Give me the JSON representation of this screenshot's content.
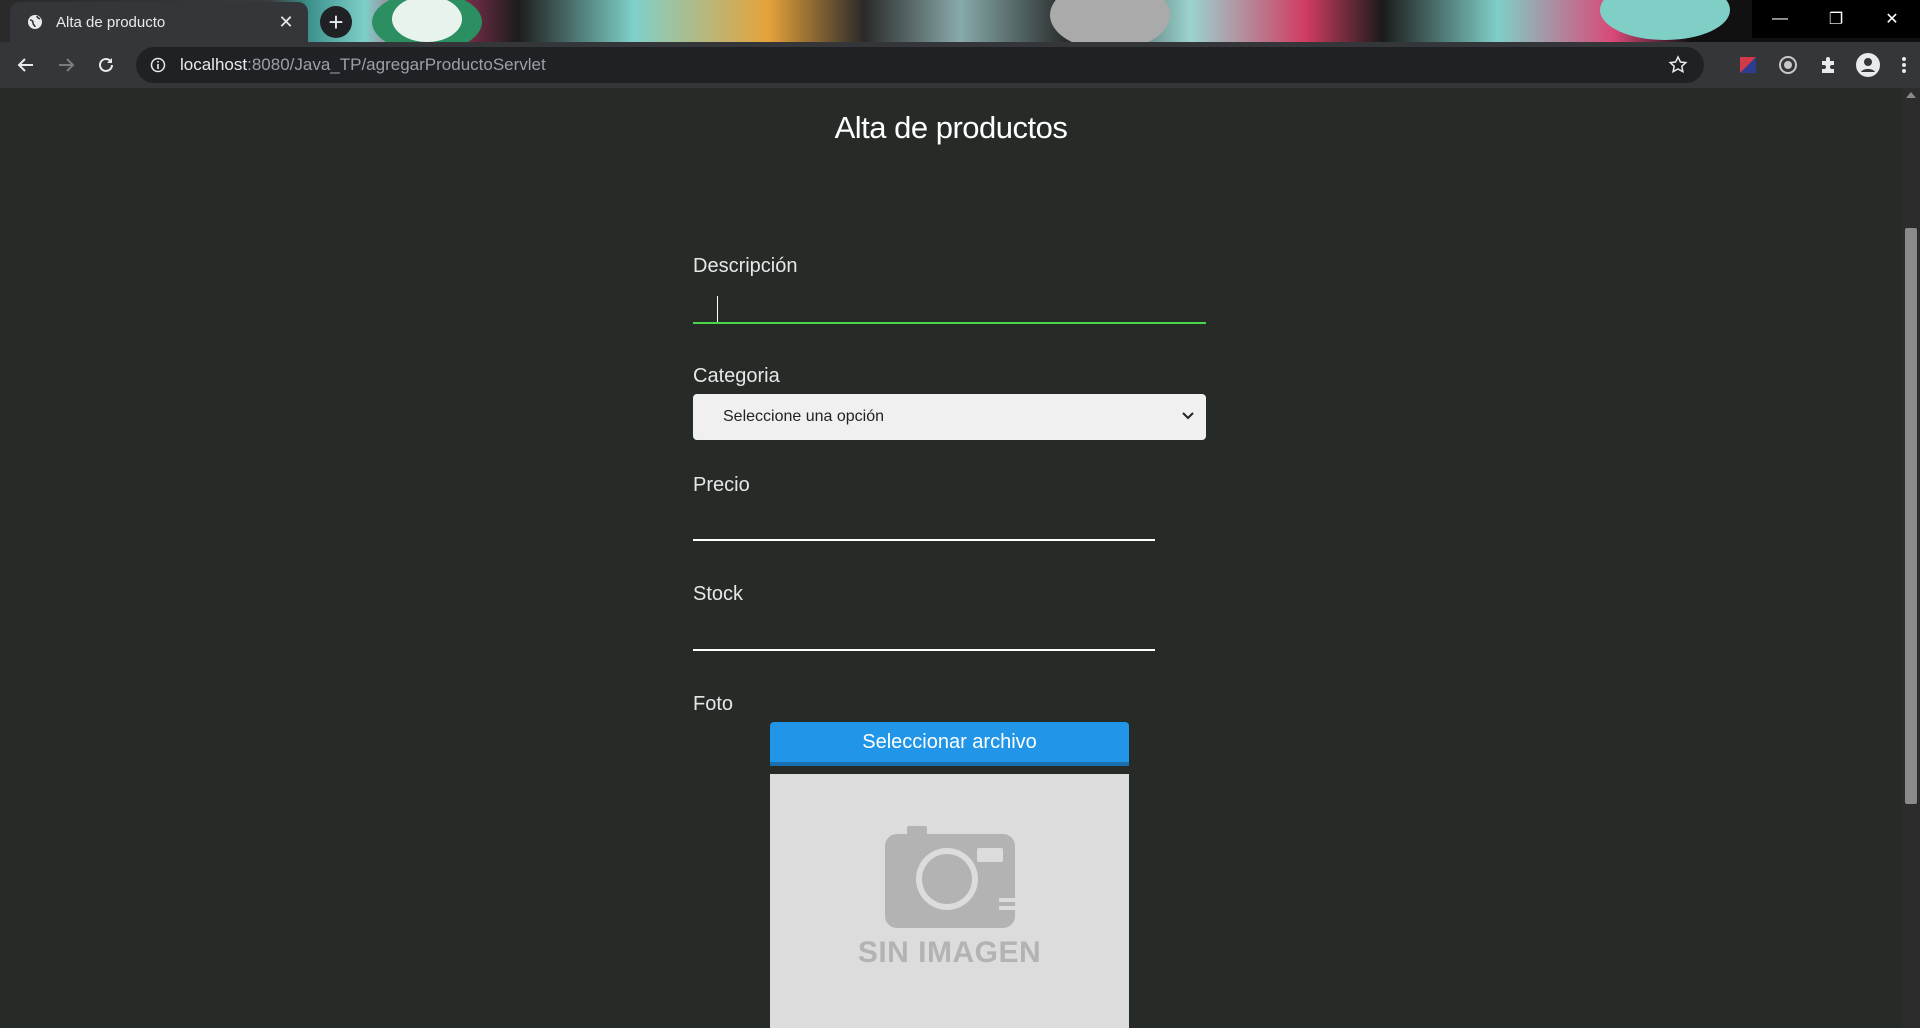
{
  "browser": {
    "tab_title": "Alta de producto",
    "url_host": "localhost",
    "url_rest": ":8080/Java_TP/agregarProductoServlet"
  },
  "page": {
    "title": "Alta de productos",
    "fields": {
      "descripcion_label": "Descripción",
      "descripcion_value": "",
      "categoria_label": "Categoria",
      "categoria_selected": "Seleccione una opción",
      "precio_label": "Precio",
      "precio_value": "",
      "stock_label": "Stock",
      "stock_value": "",
      "foto_label": "Foto",
      "file_button": "Seleccionar archivo",
      "no_image_text": "SIN IMAGEN"
    }
  },
  "colors": {
    "page_bg": "#272b28",
    "focus_underline": "#4ad54a",
    "file_button_bg": "#2196e8"
  },
  "icons": [
    "globe-icon",
    "close-icon",
    "plus-icon",
    "back-icon",
    "forward-icon",
    "reload-icon",
    "info-icon",
    "star-icon",
    "extension-icon",
    "profile-icon",
    "menu-icon",
    "camera-icon",
    "chevron-down-icon"
  ]
}
